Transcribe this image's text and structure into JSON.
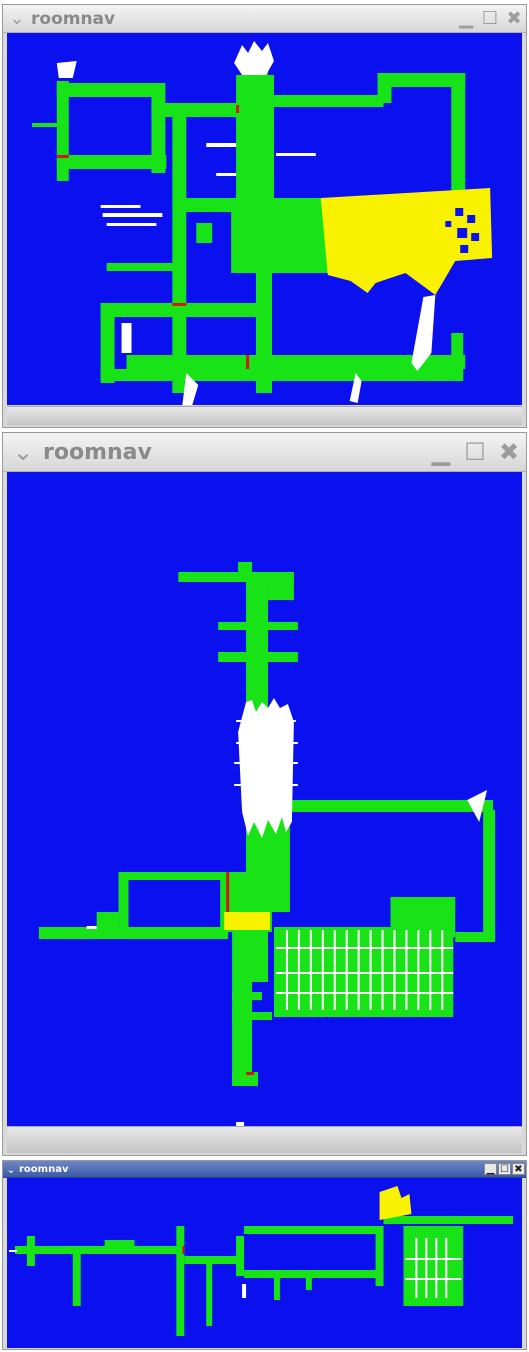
{
  "windows": [
    {
      "title": "roomnav",
      "menu_icon": "chevron-down-icon",
      "minimize_icon": "minimize-icon",
      "maximize_icon": "maximize-icon",
      "close_icon": "close-icon"
    },
    {
      "title": "roomnav",
      "menu_icon": "chevron-down-icon",
      "minimize_icon": "minimize-icon",
      "maximize_icon": "maximize-icon",
      "close_icon": "close-icon"
    },
    {
      "title": "roomnav",
      "menu_icon": "chevron-down-icon",
      "minimize_icon": "minimize-icon",
      "maximize_icon": "maximize-icon",
      "close_icon": "close-icon"
    }
  ],
  "glyphs": {
    "menu": "⌄",
    "minimize": "▁",
    "maximize": "☐",
    "close": "✖"
  },
  "colors": {
    "background": "#0a10ee",
    "free_space": "#17e317",
    "current_room": "#f8f200",
    "unknown_obstacle": "#ffffff",
    "door": "#d01818",
    "titlebar_active": "#3a5aa8"
  }
}
